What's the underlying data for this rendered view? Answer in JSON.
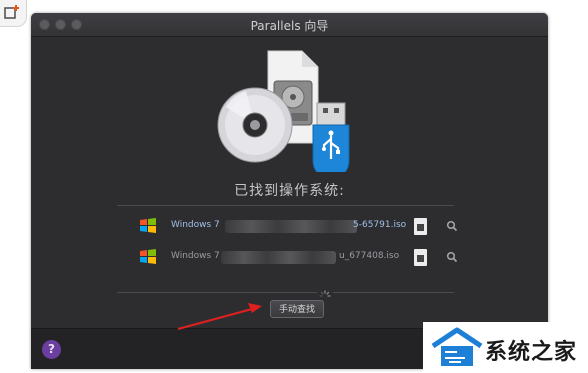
{
  "window": {
    "title": "Parallels 向导"
  },
  "main": {
    "heading": "已找到操作系统:",
    "results": [
      {
        "os": "Windows 7",
        "iso_suffix": "5-65791.iso"
      },
      {
        "os": "Windows 7",
        "iso_suffix": "u_677408.iso"
      }
    ],
    "find_button": "手动查找"
  },
  "footer": {
    "help": "?"
  },
  "watermark": {
    "text": "系统之家"
  },
  "colors": {
    "window_bg": "#2d2d30",
    "link": "#9fc0e8",
    "arrow": "#e02020",
    "help": "#6b3fa0",
    "usb": "#1d86d8"
  }
}
